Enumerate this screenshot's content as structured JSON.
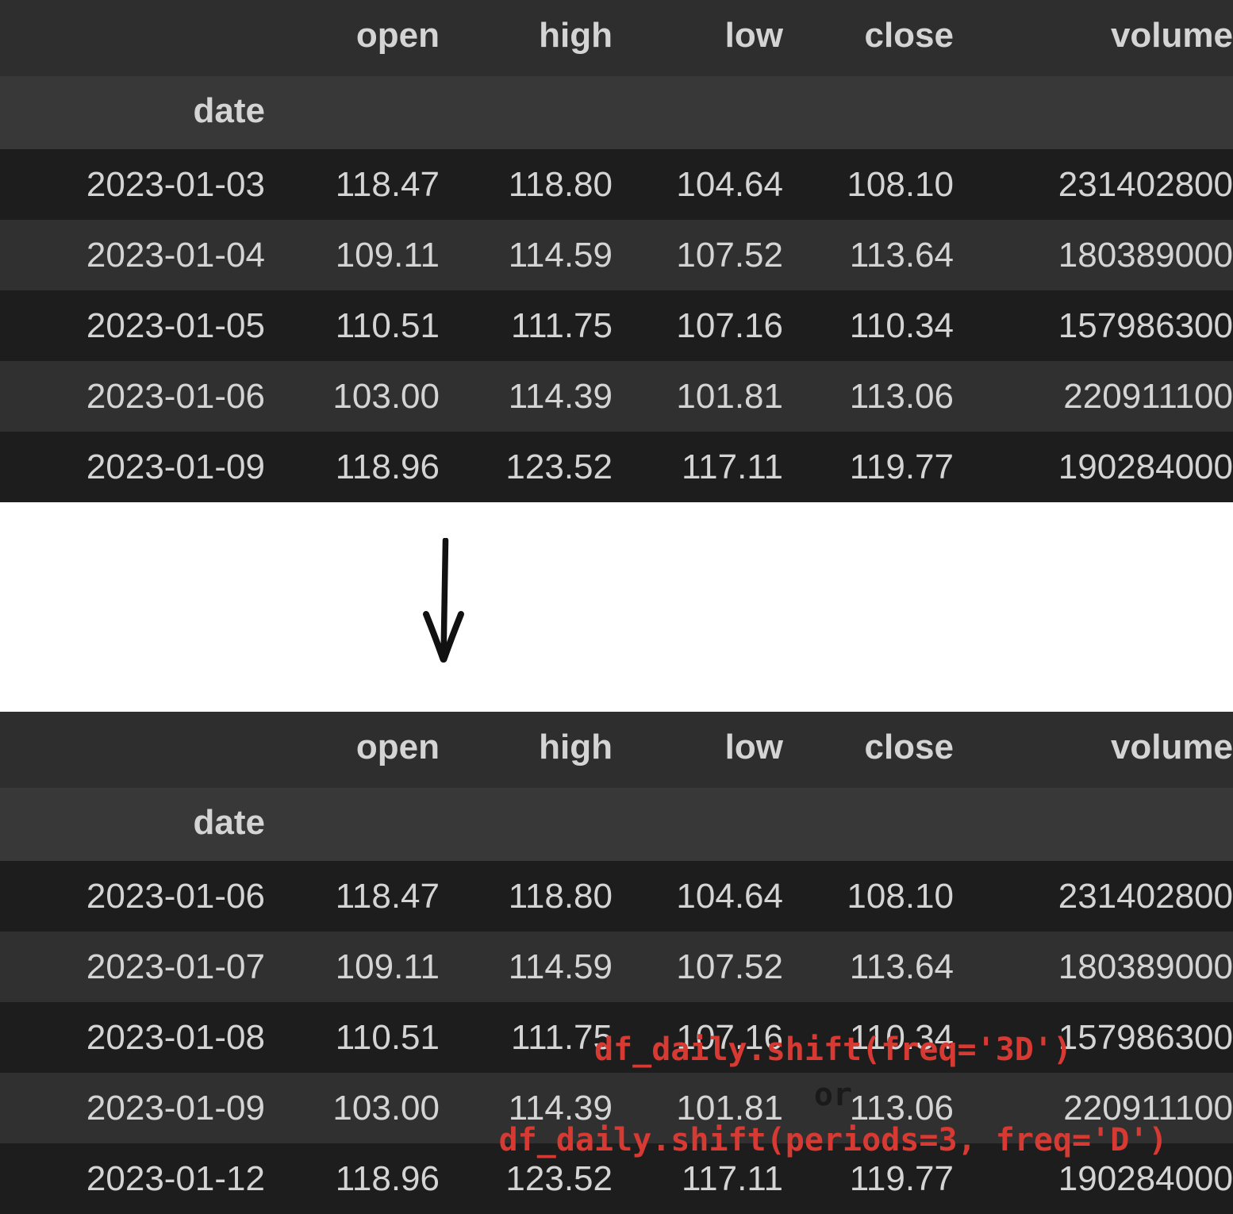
{
  "columns": [
    "open",
    "high",
    "low",
    "close",
    "volume"
  ],
  "index_name": "date",
  "tables": [
    {
      "id": "df_daily_original",
      "rows": [
        {
          "date": "2023-01-03",
          "open": "118.47",
          "high": "118.80",
          "low": "104.64",
          "close": "108.10",
          "volume": "231402800"
        },
        {
          "date": "2023-01-04",
          "open": "109.11",
          "high": "114.59",
          "low": "107.52",
          "close": "113.64",
          "volume": "180389000"
        },
        {
          "date": "2023-01-05",
          "open": "110.51",
          "high": "111.75",
          "low": "107.16",
          "close": "110.34",
          "volume": "157986300"
        },
        {
          "date": "2023-01-06",
          "open": "103.00",
          "high": "114.39",
          "low": "101.81",
          "close": "113.06",
          "volume": "220911100"
        },
        {
          "date": "2023-01-09",
          "open": "118.96",
          "high": "123.52",
          "low": "117.11",
          "close": "119.77",
          "volume": "190284000"
        }
      ]
    },
    {
      "id": "df_daily_shifted",
      "rows": [
        {
          "date": "2023-01-06",
          "open": "118.47",
          "high": "118.80",
          "low": "104.64",
          "close": "108.10",
          "volume": "231402800"
        },
        {
          "date": "2023-01-07",
          "open": "109.11",
          "high": "114.59",
          "low": "107.52",
          "close": "113.64",
          "volume": "180389000"
        },
        {
          "date": "2023-01-08",
          "open": "110.51",
          "high": "111.75",
          "low": "107.16",
          "close": "110.34",
          "volume": "157986300"
        },
        {
          "date": "2023-01-09",
          "open": "103.00",
          "high": "114.39",
          "low": "101.81",
          "close": "113.06",
          "volume": "220911100"
        },
        {
          "date": "2023-01-12",
          "open": "118.96",
          "high": "123.52",
          "low": "117.11",
          "close": "119.77",
          "volume": "190284000"
        }
      ]
    }
  ],
  "annotation": {
    "code_line_1": "df_daily.shift(freq='3D')",
    "separator": "or",
    "code_line_2": "df_daily.shift(periods=3, freq='D')",
    "arrow": "down-arrow"
  },
  "colors": {
    "code_red": "#d63a33",
    "highlight_green": "#4aa css",
    "header_bg": "#2e2e2e",
    "index_header_bg": "#383838",
    "row_odd_bg": "#1d1d1d",
    "row_even_bg": "#303030",
    "text": "#d4d4d4",
    "page_bg": "#ffffff"
  }
}
